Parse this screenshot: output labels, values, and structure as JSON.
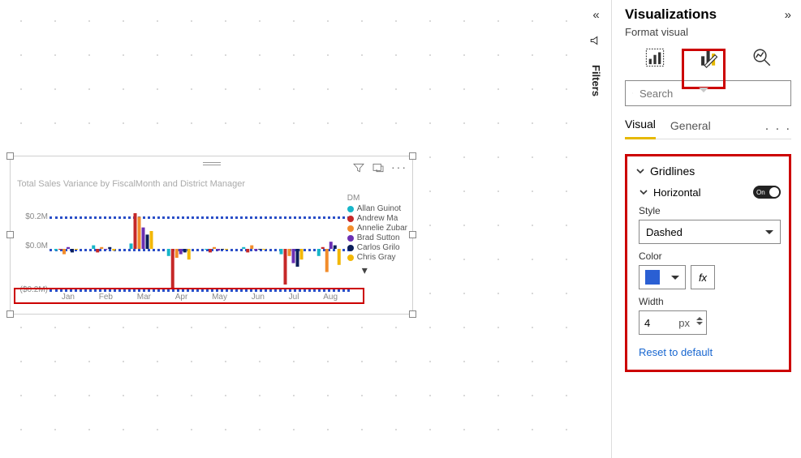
{
  "canvas": {
    "tile": {
      "title": "Total Sales Variance by FiscalMonth and District Manager",
      "y_ticks": [
        "$0.2M",
        "$0.0M",
        "($0.2M)"
      ],
      "x_ticks": [
        "Jan",
        "Feb",
        "Mar",
        "Apr",
        "May",
        "Jun",
        "Jul",
        "Aug"
      ],
      "legend_header": "DM",
      "legend": [
        {
          "name": "Allan Guinot",
          "color": "#17b6c9"
        },
        {
          "name": "Andrew Ma",
          "color": "#c62828"
        },
        {
          "name": "Annelie Zubar",
          "color": "#f28c2a"
        },
        {
          "name": "Brad Sutton",
          "color": "#6b2fb3"
        },
        {
          "name": "Carlos Grilo",
          "color": "#0b1e5b"
        },
        {
          "name": "Chris Gray",
          "color": "#f2b705"
        }
      ],
      "more_indicator": "▾"
    }
  },
  "chart_data": {
    "type": "bar",
    "title": "Total Sales Variance by FiscalMonth and District Manager",
    "xlabel": "",
    "ylabel": "",
    "ylim": [
      -0.25,
      0.25
    ],
    "y_tick_values": [
      0.2,
      0.0,
      -0.2
    ],
    "categories": [
      "Jan",
      "Feb",
      "Mar",
      "Apr",
      "May",
      "Jun",
      "Jul",
      "Aug"
    ],
    "series": [
      {
        "name": "Allan Guinot",
        "color": "#17b6c9",
        "values": [
          -0.01,
          0.02,
          0.03,
          -0.04,
          0.0,
          0.01,
          -0.03,
          -0.04
        ]
      },
      {
        "name": "Andrew Ma",
        "color": "#c62828",
        "values": [
          0.0,
          -0.02,
          0.2,
          -0.22,
          -0.02,
          -0.02,
          -0.2,
          0.01
        ]
      },
      {
        "name": "Annelie Zubar",
        "color": "#f28c2a",
        "values": [
          -0.03,
          0.01,
          0.18,
          -0.05,
          0.01,
          0.02,
          -0.04,
          -0.13
        ]
      },
      {
        "name": "Brad Sutton",
        "color": "#6b2fb3",
        "values": [
          0.01,
          0.0,
          0.12,
          -0.03,
          -0.01,
          -0.01,
          -0.08,
          0.04
        ]
      },
      {
        "name": "Carlos Grilo",
        "color": "#0b1e5b",
        "values": [
          -0.02,
          0.01,
          0.08,
          -0.02,
          0.0,
          0.0,
          -0.1,
          0.02
        ]
      },
      {
        "name": "Chris Gray",
        "color": "#f2b705",
        "values": [
          0.0,
          -0.01,
          0.1,
          -0.06,
          0.0,
          0.0,
          -0.06,
          -0.09
        ]
      }
    ]
  },
  "filters": {
    "label": "Filters"
  },
  "pane": {
    "title": "Visualizations",
    "subtitle": "Format visual",
    "search_placeholder": "Search",
    "tabs": {
      "visual": "Visual",
      "general": "General"
    },
    "gridlines": {
      "header": "Gridlines",
      "horizontal": "Horizontal",
      "toggle_label": "On",
      "style_label": "Style",
      "style_value": "Dashed",
      "color_label": "Color",
      "color_value": "#2a5fd3",
      "fx_label": "fx",
      "width_label": "Width",
      "width_value": "4",
      "width_unit": "px",
      "reset": "Reset to default"
    }
  }
}
